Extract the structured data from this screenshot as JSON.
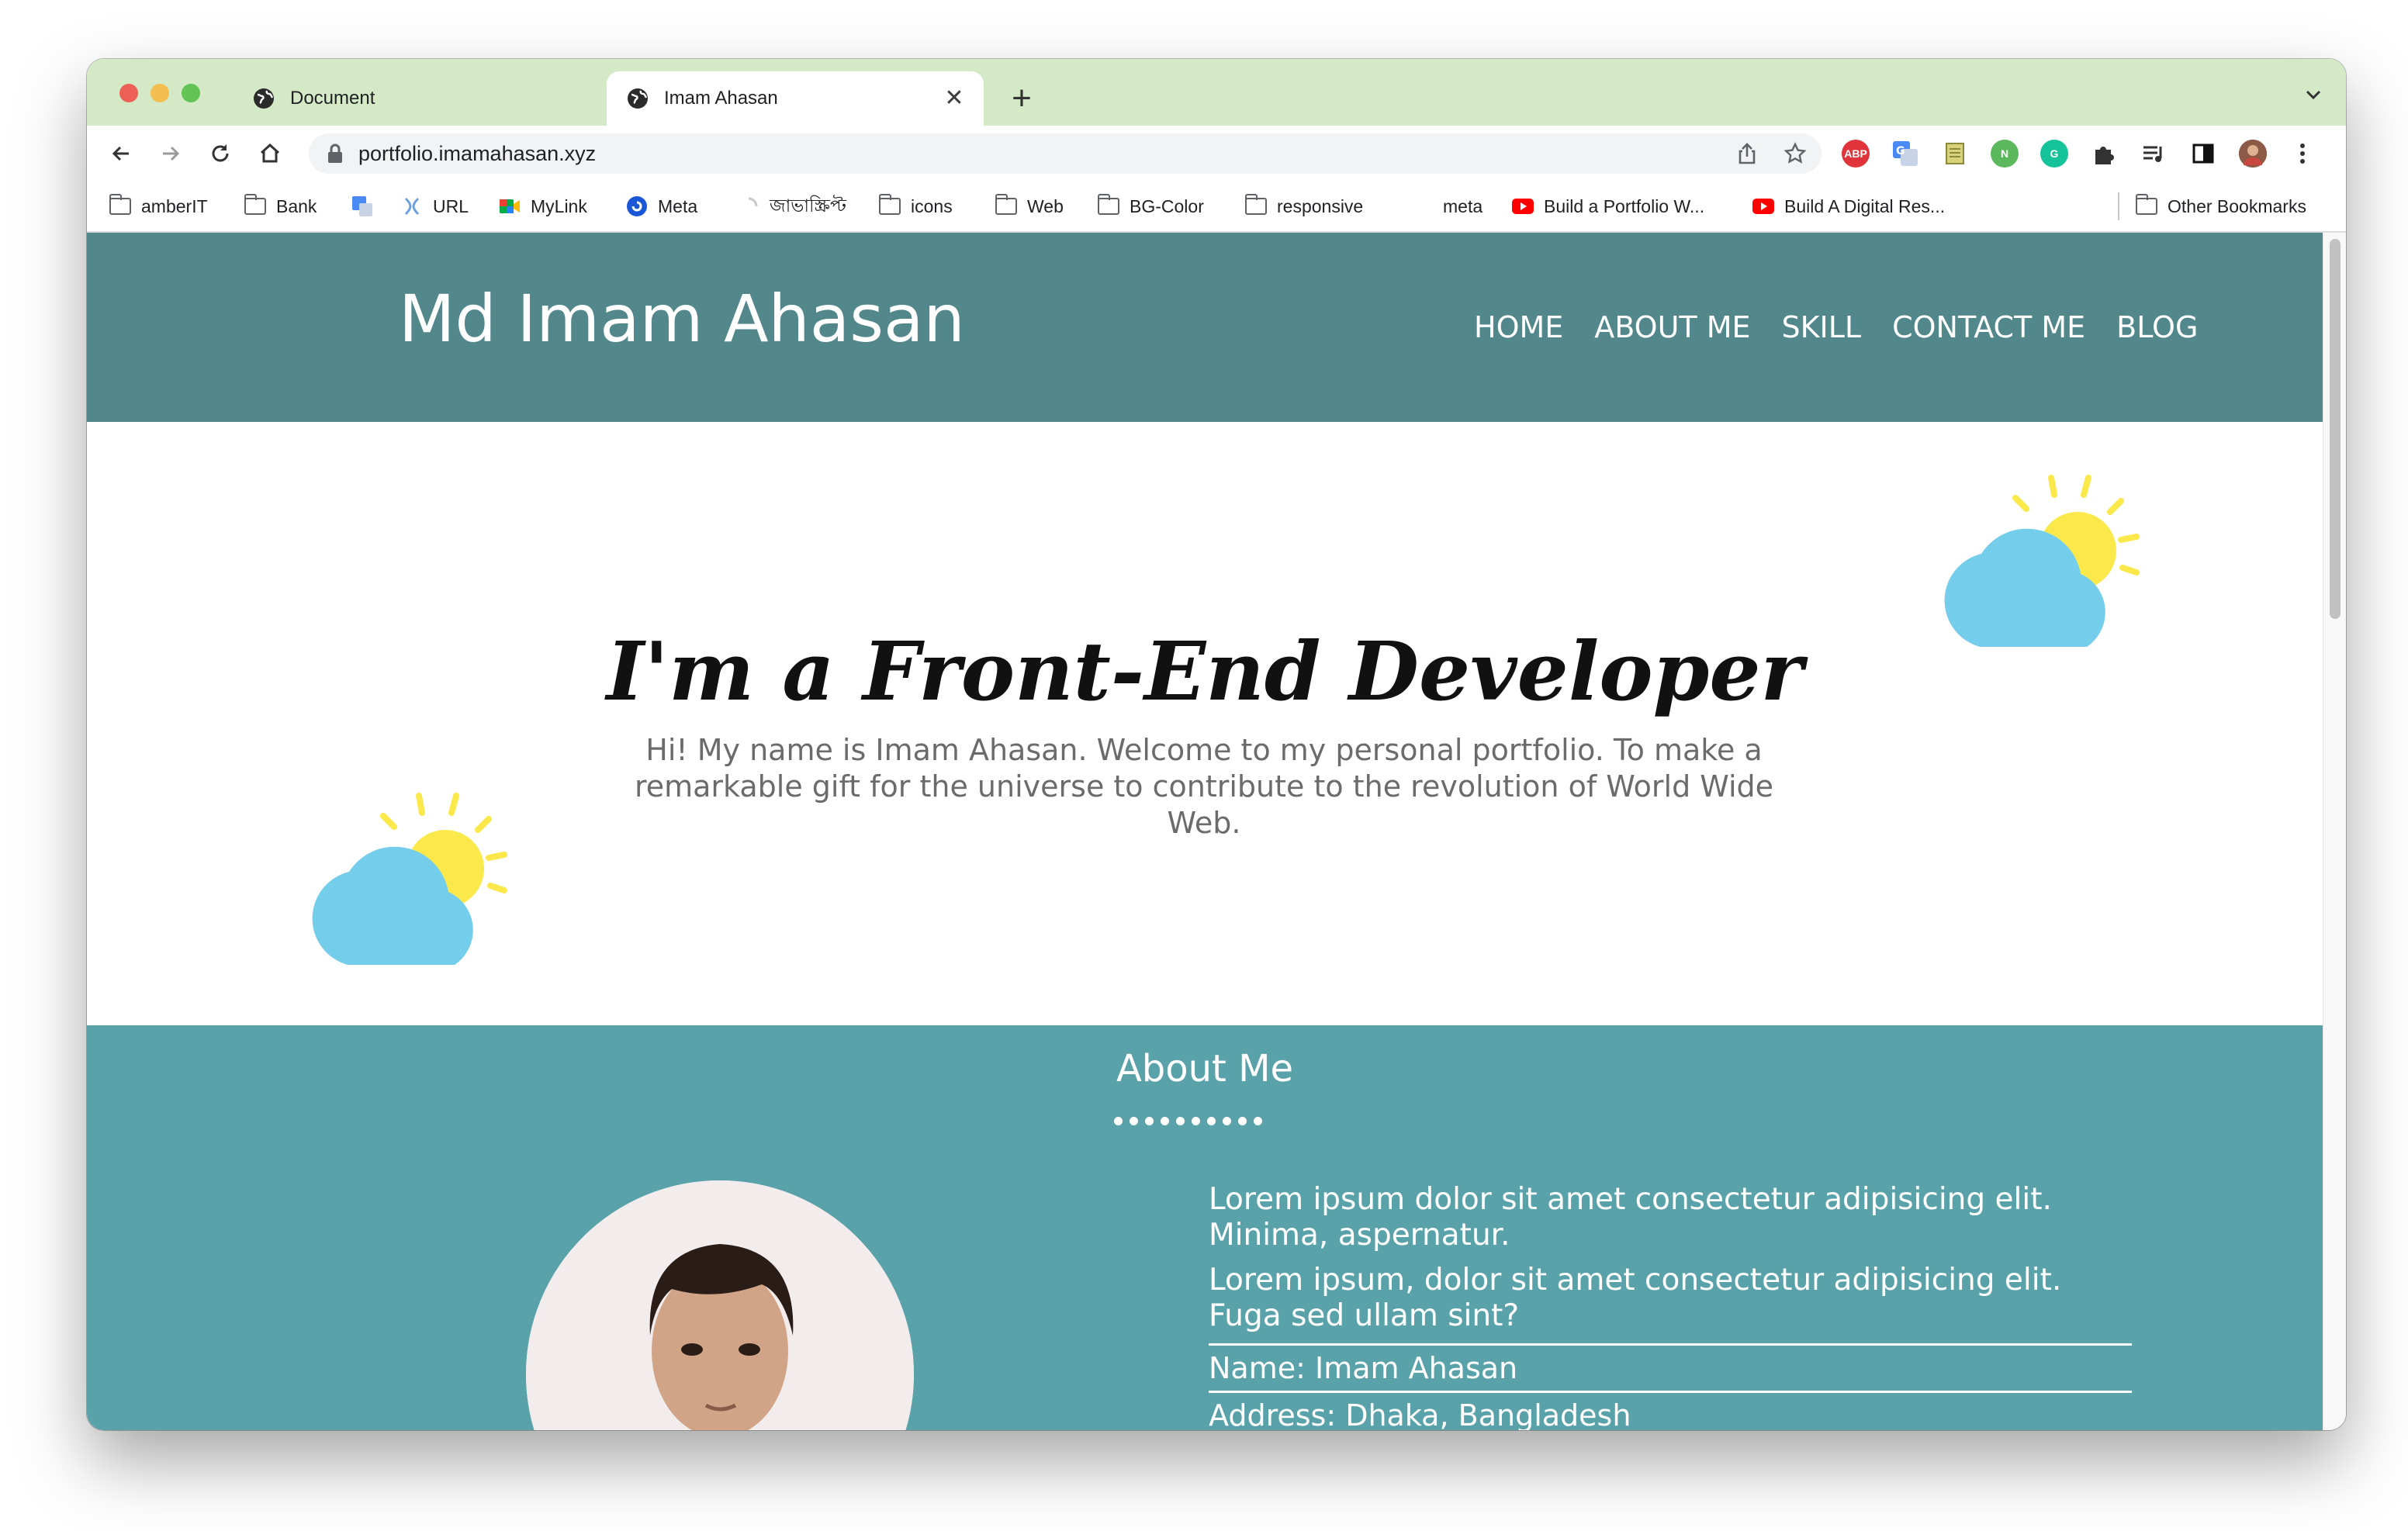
{
  "browser": {
    "tabs": [
      {
        "title": "Document",
        "close": "✕"
      },
      {
        "title": "Imam Ahasan",
        "close": "✕"
      }
    ],
    "new_tab": "+",
    "address": "portfolio.imamahasan.xyz",
    "extensions": {
      "abp": "ABP",
      "n": "N",
      "g": "G"
    },
    "bookmarks": [
      "amberIT",
      "Bank",
      "URL",
      "MyLink",
      "Meta",
      "জাভাস্ক্রিপ্ট",
      "icons",
      "Web",
      "BG-Color",
      "responsive",
      "meta",
      "Build a Portfolio W...",
      "Build A Digital Res..."
    ],
    "other_bookmarks": "Other Bookmarks"
  },
  "site": {
    "brand": "Md Imam Ahasan",
    "nav": [
      "HOME",
      "ABOUT ME",
      "SKILL",
      "CONTACT ME",
      "BLOG"
    ],
    "hero": {
      "title": "I'm a Front-End Developer",
      "subtitle": "Hi! My name is Imam Ahasan. Welcome to my personal portfolio. To make a remarkable gift for the universe to contribute to the revolution of World Wide Web."
    },
    "about": {
      "title": "About Me",
      "paragraphs": [
        "Lorem ipsum dolor sit amet consectetur adipisicing elit. Minima, aspernatur.",
        "Lorem ipsum, dolor sit amet consectetur adipisicing elit. Fuga sed ullam sint?"
      ],
      "name": "Name: Imam Ahasan",
      "address": "Address: Dhaka, Bangladesh"
    }
  },
  "colors": {
    "tab_strip": "#d4e9c5",
    "header": "#52878b",
    "about": "#5aa2aa",
    "cloud": "#74cdea",
    "sun": "#fbe84a"
  }
}
